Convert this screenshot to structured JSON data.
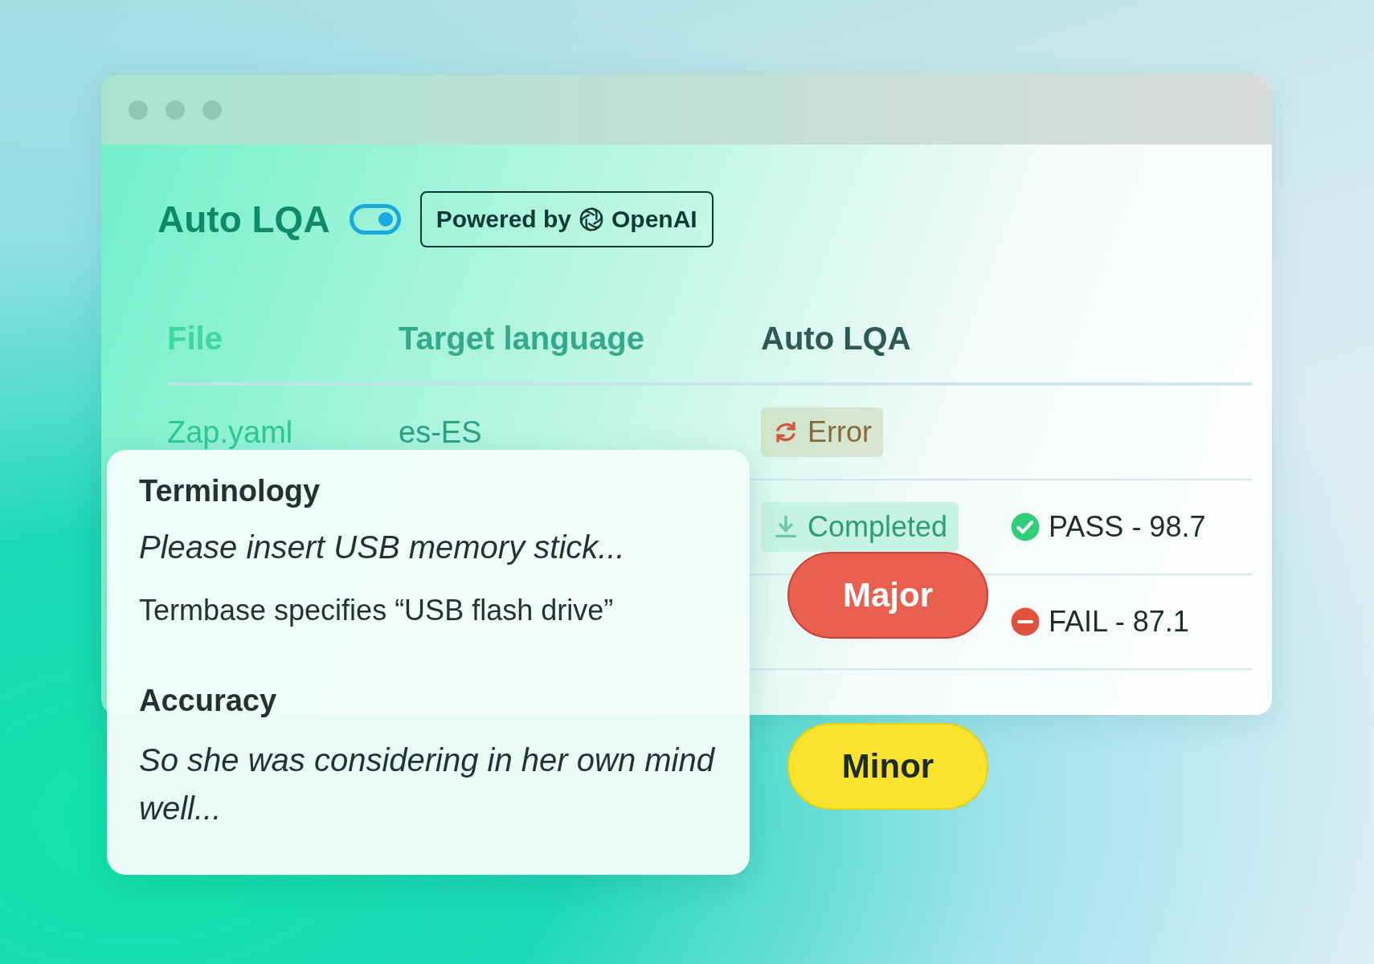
{
  "header": {
    "title": "Auto LQA",
    "toggle_on": true,
    "badge": {
      "prefix": "Powered by",
      "brand": "OpenAI"
    }
  },
  "table": {
    "columns": [
      "File",
      "Target language",
      "Auto LQA"
    ],
    "rows": [
      {
        "file": "Zap.yaml",
        "language": "es-ES",
        "status": {
          "kind": "error",
          "label": "Error"
        }
      },
      {
        "status": {
          "kind": "completed",
          "label": "Completed"
        },
        "result": {
          "kind": "pass",
          "label": "PASS - 98.7"
        }
      },
      {
        "result": {
          "kind": "fail",
          "label": "FAIL - 87.1"
        }
      }
    ]
  },
  "issues": [
    {
      "category": "Terminology",
      "example": "Please insert USB memory stick...",
      "note": "Termbase specifies “USB flash drive”",
      "severity": {
        "kind": "major",
        "label": "Major"
      }
    },
    {
      "category": "Accuracy",
      "example": "So she was considering in her own mind well...",
      "severity": {
        "kind": "minor",
        "label": "Minor"
      }
    }
  ]
}
